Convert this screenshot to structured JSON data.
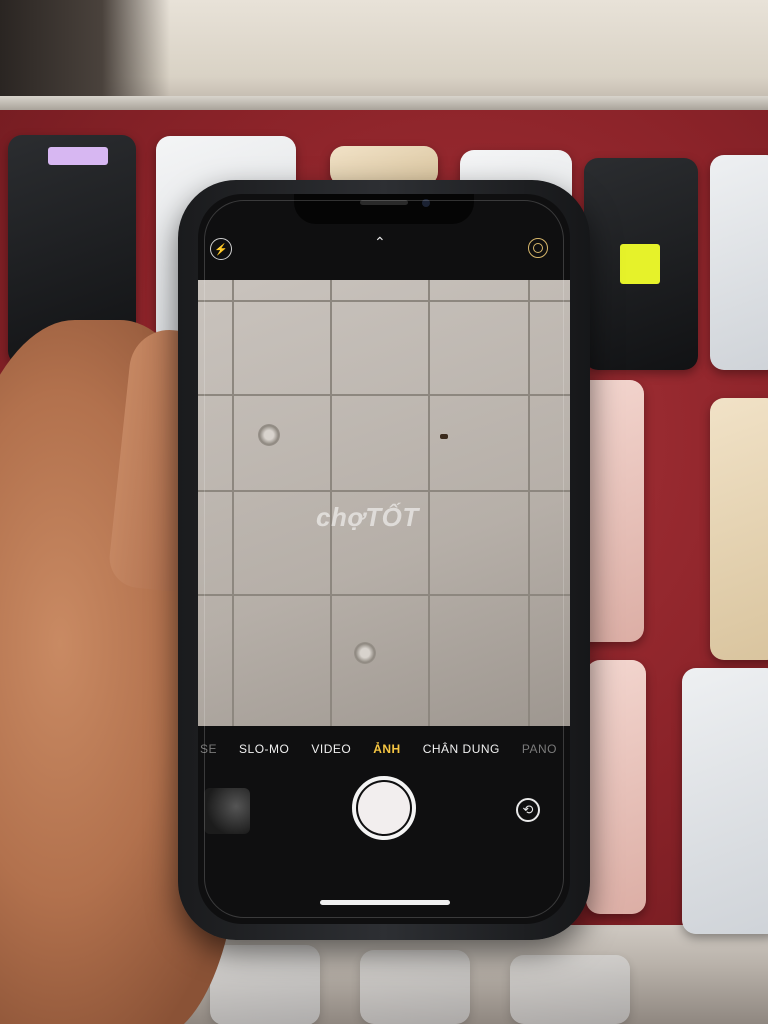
{
  "camera": {
    "modes": [
      "SE",
      "SLO-MO",
      "VIDEO",
      "ẢNH",
      "CHÂN DUNG",
      "PANO"
    ],
    "active_mode": "ẢNH",
    "flash_symbol": "⚡",
    "chevron_symbol": "⌃",
    "flip_symbol": "⟲"
  },
  "watermark": {
    "text": "chợTỐT"
  },
  "colors": {
    "active_mode": "#f5c542",
    "tray_red": "#8b2329",
    "phone_black": "#1a1b1d"
  }
}
